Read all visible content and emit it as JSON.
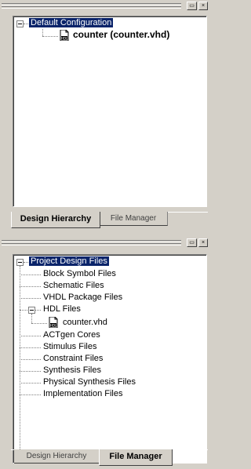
{
  "top_panel": {
    "tree": {
      "root": "Default Configuration",
      "child": "counter (counter.vhd)",
      "child_icon": "vhdl-file-icon"
    },
    "tabs": [
      "Design Hierarchy",
      "File Manager"
    ],
    "active_tab": "Design Hierarchy"
  },
  "bottom_panel": {
    "tree": {
      "root": "Project Design Files",
      "items": [
        "Block Symbol Files",
        "Schematic Files",
        "VHDL Package Files",
        "HDL Files",
        "ACTgen Cores",
        "Stimulus Files",
        "Constraint Files",
        "Synthesis Files",
        "Physical Synthesis Files",
        "Implementation Files"
      ],
      "hdl_child": "counter.vhd",
      "hdl_child_icon": "vhdl-file-icon"
    },
    "tabs": [
      "Design Hierarchy",
      "File Manager"
    ],
    "active_tab": "File Manager"
  },
  "colors": {
    "selection": "#0a246a",
    "face": "#d4d0c8"
  },
  "icons": {
    "title_buttons": [
      "restore-icon",
      "close-icon"
    ],
    "tree_toggle": "collapse-minus-icon"
  }
}
